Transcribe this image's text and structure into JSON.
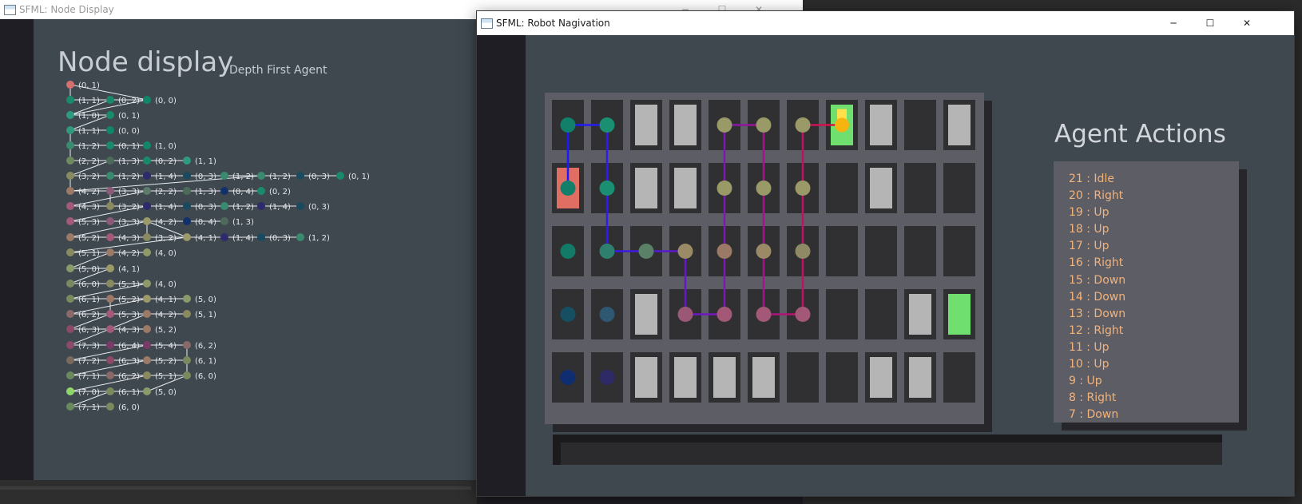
{
  "node_window": {
    "title": "SFML: Node Display",
    "controls": {
      "minimize": "─",
      "maximize": "☐",
      "close": "✕"
    },
    "heading": "Node display",
    "subheading": "Depth First Agent",
    "nodes": [
      {
        "label": "(0, 1)",
        "color": "#d4716e"
      },
      {
        "label": "(1, 1)",
        "color": "#1b8a6b"
      },
      {
        "label": "(0, 2)",
        "color": "#1b8a6b"
      },
      {
        "label": "(0, 0)",
        "color": "#12856a"
      },
      {
        "label": "(1, 0)",
        "color": "#2f9a7d"
      },
      {
        "label": "(0, 1)",
        "color": "#1b8a6b"
      },
      {
        "label": "(1, 1)",
        "color": "#2f9a7d"
      },
      {
        "label": "(0, 0)",
        "color": "#12856a"
      },
      {
        "label": "(1, 2)",
        "color": "#3a8a70"
      },
      {
        "label": "(0, 1)",
        "color": "#1b8a6b"
      },
      {
        "label": "(1, 0)",
        "color": "#12856a"
      },
      {
        "label": "(2, 2)",
        "color": "#6d8b5f"
      },
      {
        "label": "(1, 3)",
        "color": "#4d6b5a"
      },
      {
        "label": "(0, 2)",
        "color": "#1b8a6b"
      },
      {
        "label": "(1, 1)",
        "color": "#2f9a7d"
      },
      {
        "label": "(3, 2)",
        "color": "#8a8a60"
      },
      {
        "label": "(1, 2)",
        "color": "#3a8a70"
      },
      {
        "label": "(1, 4)",
        "color": "#2e2a6b"
      },
      {
        "label": "(0, 3)",
        "color": "#1a4a5e"
      },
      {
        "label": "(1, 2)",
        "color": "#3a8a70"
      },
      {
        "label": "(1, 2)",
        "color": "#3a8a70"
      },
      {
        "label": "(0, 3)",
        "color": "#1a4a5e"
      },
      {
        "label": "(0, 1)",
        "color": "#1b8a6b"
      },
      {
        "label": "(4, 2)",
        "color": "#9c7a68"
      },
      {
        "label": "(3, 3)",
        "color": "#8a5a78"
      },
      {
        "label": "(2, 2)",
        "color": "#5e7a6a"
      },
      {
        "label": "(1, 3)",
        "color": "#4d6b5a"
      },
      {
        "label": "(0, 4)",
        "color": "#12306a"
      },
      {
        "label": "(0, 2)",
        "color": "#1b8a6b"
      },
      {
        "label": "(4, 3)",
        "color": "#a25a78"
      },
      {
        "label": "(3, 2)",
        "color": "#8a8a60"
      },
      {
        "label": "(1, 4)",
        "color": "#2e2a6b"
      },
      {
        "label": "(0, 3)",
        "color": "#1a4a5e"
      },
      {
        "label": "(1, 2)",
        "color": "#3a8a70"
      },
      {
        "label": "(1, 4)",
        "color": "#2e2a6b"
      },
      {
        "label": "(0, 3)",
        "color": "#1a4a5e"
      },
      {
        "label": "(5, 3)",
        "color": "#a25a78"
      },
      {
        "label": "(3, 3)",
        "color": "#8a5a78"
      },
      {
        "label": "(4, 2)",
        "color": "#9c9a6a"
      },
      {
        "label": "(0, 4)",
        "color": "#12306a"
      },
      {
        "label": "(1, 3)",
        "color": "#4d6b5a"
      },
      {
        "label": "(5, 2)",
        "color": "#9c7a68"
      },
      {
        "label": "(4, 3)",
        "color": "#a25a78"
      },
      {
        "label": "(3, 2)",
        "color": "#8a8a60"
      },
      {
        "label": "(4, 1)",
        "color": "#9c9a6a"
      },
      {
        "label": "(1, 4)",
        "color": "#2e2a6b"
      },
      {
        "label": "(0, 3)",
        "color": "#1a4a5e"
      },
      {
        "label": "(1, 2)",
        "color": "#3a8a70"
      },
      {
        "label": "(5, 1)",
        "color": "#8a8a60"
      },
      {
        "label": "(4, 2)",
        "color": "#9c7a68"
      },
      {
        "label": "(4, 0)",
        "color": "#8f9a6a"
      },
      {
        "label": "(5, 0)",
        "color": "#8a9a6a"
      },
      {
        "label": "(4, 1)",
        "color": "#9c9a6a"
      },
      {
        "label": "(6, 0)",
        "color": "#7a8a5e"
      },
      {
        "label": "(5, 1)",
        "color": "#8a8a60"
      },
      {
        "label": "(4, 0)",
        "color": "#8f9a6a"
      },
      {
        "label": "(6, 1)",
        "color": "#7a8a5e"
      },
      {
        "label": "(5, 2)",
        "color": "#9c7a68"
      },
      {
        "label": "(4, 1)",
        "color": "#9c9a6a"
      },
      {
        "label": "(5, 0)",
        "color": "#8a9a6a"
      },
      {
        "label": "(6, 2)",
        "color": "#8a6a68"
      },
      {
        "label": "(5, 3)",
        "color": "#a25a78"
      },
      {
        "label": "(4, 2)",
        "color": "#9c7a68"
      },
      {
        "label": "(5, 1)",
        "color": "#8a8a60"
      },
      {
        "label": "(6, 3)",
        "color": "#8a4a68"
      },
      {
        "label": "(4, 3)",
        "color": "#a25a78"
      },
      {
        "label": "(5, 2)",
        "color": "#9c7a68"
      },
      {
        "label": "(7, 3)",
        "color": "#8a4a68"
      },
      {
        "label": "(6, 4)",
        "color": "#7a3a68"
      },
      {
        "label": "(5, 4)",
        "color": "#7a3a68"
      },
      {
        "label": "(6, 2)",
        "color": "#8a6a68"
      },
      {
        "label": "(7, 2)",
        "color": "#7a6a5e"
      },
      {
        "label": "(6, 3)",
        "color": "#8a4a68"
      },
      {
        "label": "(5, 2)",
        "color": "#9c7a68"
      },
      {
        "label": "(6, 1)",
        "color": "#7a8a5e"
      },
      {
        "label": "(7, 1)",
        "color": "#6a8a5e"
      },
      {
        "label": "(6, 2)",
        "color": "#8a6a68"
      },
      {
        "label": "(5, 1)",
        "color": "#8a8a60"
      },
      {
        "label": "(6, 0)",
        "color": "#7a8a5e"
      },
      {
        "label": "(7, 0)",
        "color": "#8fd66a"
      },
      {
        "label": "(6, 1)",
        "color": "#7a8a5e"
      },
      {
        "label": "(5, 0)",
        "color": "#8a9a6a"
      },
      {
        "label": "(7, 1)",
        "color": "#6a8a5e"
      },
      {
        "label": "(6, 0)",
        "color": "#7a8a5e"
      }
    ]
  },
  "robot_window": {
    "title": "SFML: Robot Nagivation",
    "controls": {
      "minimize": "─",
      "maximize": "☐",
      "close": "✕"
    },
    "grid": {
      "cols": 11,
      "rows": 5,
      "walls": [
        [
          2,
          0
        ],
        [
          3,
          0
        ],
        [
          8,
          0
        ],
        [
          10,
          0
        ],
        [
          2,
          1
        ],
        [
          3,
          1
        ],
        [
          8,
          1
        ],
        [
          2,
          3
        ],
        [
          9,
          3
        ],
        [
          2,
          4
        ],
        [
          3,
          4
        ],
        [
          4,
          4
        ],
        [
          5,
          4
        ],
        [
          8,
          4
        ],
        [
          9,
          4
        ]
      ],
      "start": [
        0,
        1
      ],
      "goals": [
        [
          7,
          0
        ],
        [
          10,
          3
        ]
      ],
      "agent": [
        7,
        0
      ],
      "visited": [
        {
          "cell": [
            0,
            0
          ],
          "color": "#127f6a"
        },
        {
          "cell": [
            1,
            0
          ],
          "color": "#1a8f72"
        },
        {
          "cell": [
            4,
            0
          ],
          "color": "#9a9a68"
        },
        {
          "cell": [
            5,
            0
          ],
          "color": "#9a9a68"
        },
        {
          "cell": [
            6,
            0
          ],
          "color": "#9a9a68"
        },
        {
          "cell": [
            0,
            1
          ],
          "color": "#127f6a"
        },
        {
          "cell": [
            1,
            1
          ],
          "color": "#1a8f72"
        },
        {
          "cell": [
            4,
            1
          ],
          "color": "#9a9a68"
        },
        {
          "cell": [
            5,
            1
          ],
          "color": "#9a9a68"
        },
        {
          "cell": [
            6,
            1
          ],
          "color": "#9a9a68"
        },
        {
          "cell": [
            0,
            2
          ],
          "color": "#127a66"
        },
        {
          "cell": [
            1,
            2
          ],
          "color": "#2f7f6f"
        },
        {
          "cell": [
            2,
            2
          ],
          "color": "#5a8068"
        },
        {
          "cell": [
            3,
            2
          ],
          "color": "#9a8a66"
        },
        {
          "cell": [
            4,
            2
          ],
          "color": "#9a7a66"
        },
        {
          "cell": [
            5,
            2
          ],
          "color": "#9a8a66"
        },
        {
          "cell": [
            6,
            2
          ],
          "color": "#8f8a66"
        },
        {
          "cell": [
            0,
            3
          ],
          "color": "#164e62"
        },
        {
          "cell": [
            1,
            3
          ],
          "color": "#2e5772"
        },
        {
          "cell": [
            3,
            3
          ],
          "color": "#9a5876"
        },
        {
          "cell": [
            4,
            3
          ],
          "color": "#a25876"
        },
        {
          "cell": [
            5,
            3
          ],
          "color": "#a25876"
        },
        {
          "cell": [
            6,
            3
          ],
          "color": "#a25876"
        },
        {
          "cell": [
            0,
            4
          ],
          "color": "#0f2e72"
        },
        {
          "cell": [
            1,
            4
          ],
          "color": "#2e2a66"
        }
      ],
      "path": [
        [
          0,
          1
        ],
        [
          0,
          0
        ],
        [
          1,
          0
        ],
        [
          1,
          2
        ],
        [
          3,
          2
        ],
        [
          3,
          3
        ],
        [
          4,
          3
        ],
        [
          4,
          0
        ],
        [
          5,
          0
        ],
        [
          5,
          3
        ],
        [
          6,
          3
        ],
        [
          6,
          0
        ],
        [
          7,
          0
        ]
      ]
    },
    "actions_title": "Agent Actions",
    "actions": [
      "21 : Idle",
      "20 : Right",
      "19 : Up",
      "18 : Up",
      "17 : Up",
      "16 : Right",
      "15 : Down",
      "14 : Down",
      "13 : Down",
      "12 : Right",
      "11 : Up",
      "10 : Up",
      "9 : Up",
      "8 : Right",
      "7 : Down"
    ],
    "colors": {
      "panel": "#5d5d66",
      "cell": "#303032",
      "wall": "#b5b5b5",
      "goal": "#6fdf6f",
      "start": "#e06e62",
      "agent": "#f5b40f",
      "action_text": "#f2b37a"
    }
  }
}
